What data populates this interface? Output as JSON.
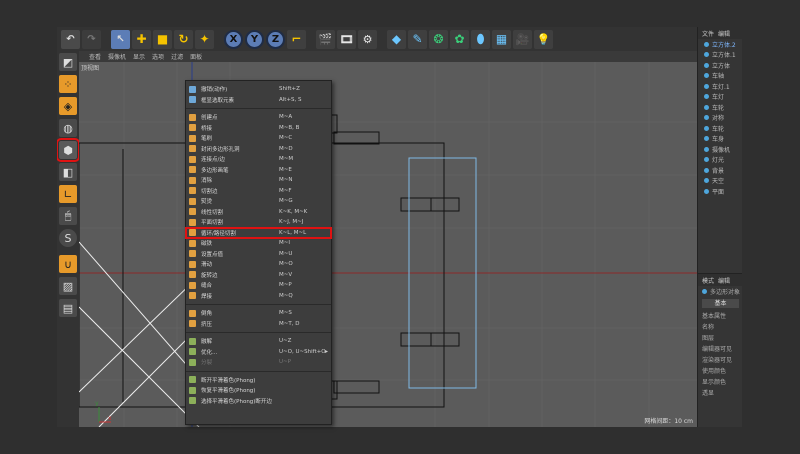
{
  "toolbar": {
    "buttons": [
      "undo-icon",
      "redo-icon",
      "select-icon",
      "move-icon",
      "scale-icon",
      "rotate-icon",
      "recent-icon",
      "x-axis-icon",
      "y-axis-icon",
      "z-axis-icon",
      "coord-icon",
      "render-view-icon",
      "render-icon",
      "render-settings-icon",
      "cube-icon",
      "pen-icon",
      "subdivide-icon",
      "generator-icon",
      "deformer-icon",
      "floor-icon",
      "camera-icon",
      "light-icon"
    ],
    "x": "X",
    "y": "Y",
    "z": "Z"
  },
  "viewport": {
    "menu": [
      "查看",
      "摄像机",
      "显示",
      "选项",
      "过滤",
      "面板"
    ],
    "label": "顶视图",
    "grid_info": "网格间距：10 cm"
  },
  "context_menu": {
    "groups": [
      [
        {
          "label": "撤销(动作)",
          "key": "Shift+Z",
          "icon": "b",
          "disabled": false
        },
        {
          "label": "框显选取元素",
          "key": "Alt+S, S",
          "icon": "b",
          "disabled": false
        }
      ],
      [
        {
          "label": "创建点",
          "key": "M~A",
          "icon": "o",
          "disabled": false
        },
        {
          "label": "桥接",
          "key": "M~B, B",
          "icon": "o",
          "disabled": false
        },
        {
          "label": "笔刷",
          "key": "M~C",
          "icon": "o",
          "disabled": false
        },
        {
          "label": "封闭多边形孔洞",
          "key": "M~D",
          "icon": "o",
          "disabled": false
        },
        {
          "label": "连接点/边",
          "key": "M~M",
          "icon": "o",
          "disabled": false
        },
        {
          "label": "多边形画笔",
          "key": "M~E",
          "icon": "o",
          "disabled": false
        },
        {
          "label": "消除",
          "key": "M~N",
          "icon": "o",
          "disabled": false
        },
        {
          "label": "切割边",
          "key": "M~F",
          "icon": "o",
          "disabled": false
        },
        {
          "label": "熨烫",
          "key": "M~G",
          "icon": "o",
          "disabled": false
        },
        {
          "label": "线性切割",
          "key": "K~K, M~K",
          "icon": "o",
          "disabled": false
        },
        {
          "label": "平面切割",
          "key": "K~J, M~J",
          "icon": "o",
          "disabled": false
        },
        {
          "label": "循环/路径切割",
          "key": "K~L, M~L",
          "icon": "o",
          "disabled": false,
          "highlighted": true
        },
        {
          "label": "磁铁",
          "key": "M~I",
          "icon": "o",
          "disabled": false
        },
        {
          "label": "设置点值",
          "key": "M~U",
          "icon": "o",
          "disabled": false
        },
        {
          "label": "滑动",
          "key": "M~O",
          "icon": "o",
          "disabled": false
        },
        {
          "label": "旋转边",
          "key": "M~V",
          "icon": "o",
          "disabled": false
        },
        {
          "label": "缝合",
          "key": "M~P",
          "icon": "o",
          "disabled": false
        },
        {
          "label": "焊接",
          "key": "M~Q",
          "icon": "o",
          "disabled": false
        }
      ],
      [
        {
          "label": "倒角",
          "key": "M~S",
          "icon": "o",
          "disabled": false
        },
        {
          "label": "挤压",
          "key": "M~T, D",
          "icon": "o",
          "disabled": false
        }
      ],
      [
        {
          "label": "融解",
          "key": "U~Z",
          "icon": "g",
          "disabled": false
        },
        {
          "label": "优化...",
          "key": "U~O, U~Shift+O",
          "icon": "g",
          "disabled": false,
          "submenu": true
        },
        {
          "label": "分裂",
          "key": "U~P",
          "icon": "g",
          "disabled": true
        }
      ],
      [
        {
          "label": "断开平滑着色(Phong)",
          "key": "",
          "icon": "g",
          "disabled": false
        },
        {
          "label": "恢复平滑着色(Phong)",
          "key": "",
          "icon": "g",
          "disabled": false
        },
        {
          "label": "选择平滑着色(Phong)断开边",
          "key": "",
          "icon": "g",
          "disabled": false
        }
      ]
    ]
  },
  "left_tools": [
    "make-editable-icon",
    "points-mode-icon",
    "edges-mode-icon",
    "polygons-mode-icon",
    "object-mode-icon",
    "model-mode-icon",
    "axis-icon",
    "tweak-icon",
    "snap-icon",
    "workplane-icon",
    "magnet-icon",
    "sculpt-icon",
    "texture-icon"
  ],
  "object_manager": {
    "tabs": [
      "文件",
      "编辑"
    ],
    "items": [
      {
        "label": "立方体.2",
        "selected": true
      },
      {
        "label": "立方体.1",
        "selected": false
      },
      {
        "label": "立方体",
        "selected": false
      },
      {
        "label": "车轴",
        "selected": false
      },
      {
        "label": "车灯.1",
        "selected": false
      },
      {
        "label": "车灯",
        "selected": false
      },
      {
        "label": "车轮",
        "selected": false
      },
      {
        "label": "对称",
        "selected": false
      },
      {
        "label": "车轮",
        "selected": false
      },
      {
        "label": "车身",
        "selected": false
      },
      {
        "label": "摄像机",
        "selected": false
      },
      {
        "label": "灯光",
        "selected": false
      },
      {
        "label": "背景",
        "selected": false
      },
      {
        "label": "天空",
        "selected": false
      },
      {
        "label": "平面",
        "selected": false
      }
    ]
  },
  "attributes": {
    "tabs": [
      "模式",
      "编辑"
    ],
    "object_label": "多边形对象",
    "basic_button": "基本",
    "section": "基本属性",
    "rows": [
      "名称",
      "图层",
      "编辑器可见",
      "渲染器可见",
      "使用颜色",
      "显示颜色",
      "透显"
    ]
  },
  "colors": {
    "highlight": "#e01212",
    "accent_orange": "#e1a040",
    "selection_blue": "#6ea8d8"
  }
}
